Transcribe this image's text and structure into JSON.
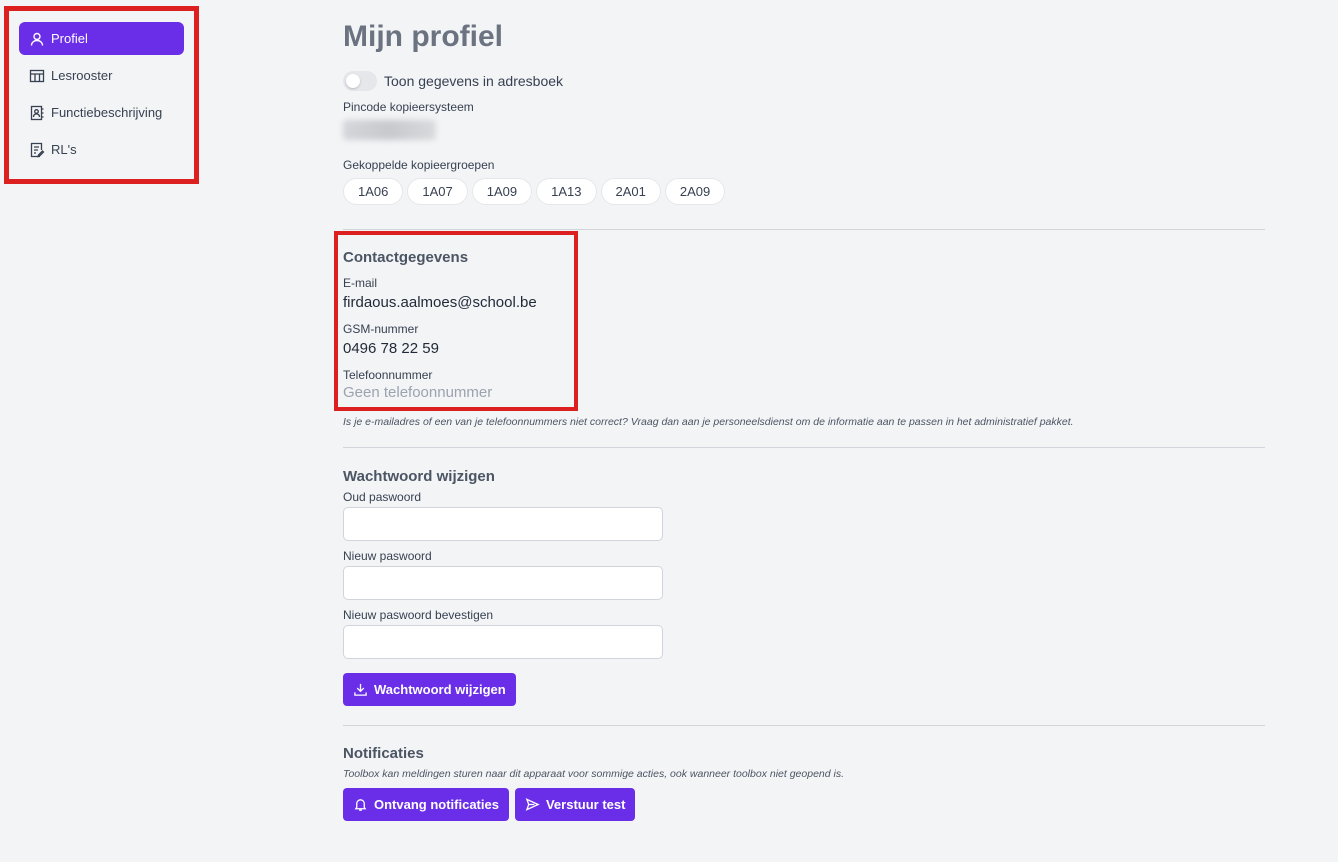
{
  "sidebar": {
    "items": [
      {
        "label": "Profiel",
        "icon": "user-icon",
        "active": true
      },
      {
        "label": "Lesrooster",
        "icon": "table-icon",
        "active": false
      },
      {
        "label": "Functiebeschrijving",
        "icon": "contact-book-icon",
        "active": false
      },
      {
        "label": "RL's",
        "icon": "edit-document-icon",
        "active": false
      }
    ]
  },
  "profile": {
    "title": "Mijn profiel",
    "toggle_label": "Toon gegevens in adresboek",
    "pin_label": "Pincode kopieersysteem",
    "groups_label": "Gekoppelde kopieergroepen",
    "groups": [
      "1A06",
      "1A07",
      "1A09",
      "1A13",
      "2A01",
      "2A09"
    ]
  },
  "contact": {
    "title": "Contactgegevens",
    "email_label": "E-mail",
    "email_value": "firdaous.aalmoes@school.be",
    "gsm_label": "GSM-nummer",
    "gsm_value": "0496 78 22 59",
    "phone_label": "Telefoonnummer",
    "phone_value": "Geen telefoonnummer",
    "note": "Is je e-mailadres of een van je telefoonnummers niet correct? Vraag dan aan je personeelsdienst om de informatie aan te passen in het administratief pakket."
  },
  "password": {
    "title": "Wachtwoord wijzigen",
    "old_label": "Oud paswoord",
    "new_label": "Nieuw paswoord",
    "confirm_label": "Nieuw paswoord bevestigen",
    "submit_label": "Wachtwoord wijzigen"
  },
  "notifications": {
    "title": "Notificaties",
    "description": "Toolbox kan meldingen sturen naar dit apparaat voor sommige acties, ook wanneer toolbox niet geopend is.",
    "receive_label": "Ontvang notificaties",
    "test_label": "Verstuur test"
  },
  "colors": {
    "accent": "#6a2ee8",
    "highlight": "#dc1f1f",
    "background": "#f3f4f6"
  }
}
